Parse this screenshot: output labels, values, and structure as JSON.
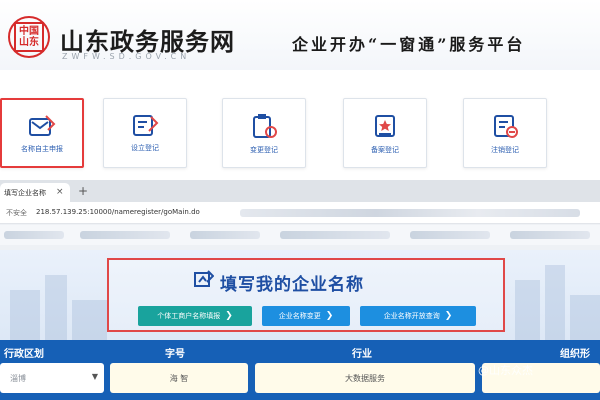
{
  "header": {
    "logo_text": "中国山东",
    "site_title": "山东政务服务网",
    "site_subtitle": "ZWFW.SD.GOV.CN",
    "platform_title": "企业开办“一窗通”服务平台"
  },
  "tiles": [
    {
      "label": "名称自主申报",
      "icon": "form-edit-icon"
    },
    {
      "label": "设立登记",
      "icon": "document-edit-icon"
    },
    {
      "label": "变更登记",
      "icon": "clipboard-refresh-icon"
    },
    {
      "label": "备案登记",
      "icon": "star-certificate-icon"
    },
    {
      "label": "注销登记",
      "icon": "document-minus-icon"
    }
  ],
  "browser": {
    "tab_title": "填写企业名称",
    "tab_close": "×",
    "new_tab": "+",
    "security_label": "不安全",
    "url": "218.57.139.25:10000/nameregister/goMain.do"
  },
  "name_section": {
    "title": "填写我的企业名称",
    "buttons": [
      {
        "label": "个体工商户名称填报"
      },
      {
        "label": "企业名称变更"
      },
      {
        "label": "企业名称开放查询"
      }
    ]
  },
  "query_bar": {
    "columns": [
      "行政区划",
      "字号",
      "行业",
      "组织形"
    ],
    "region_value": "淄博",
    "zihao_value": "海 智",
    "hangye_value": "大数据服务",
    "org_value": ""
  },
  "watermark": "@山东众杰",
  "colors": {
    "brand_red": "#d62b2b",
    "highlight_red": "#e53b3b",
    "teal_button": "#19a39d",
    "blue_button": "#1d8fe0",
    "query_bar_blue": "#1660b6",
    "title_blue": "#1f4fa3"
  }
}
